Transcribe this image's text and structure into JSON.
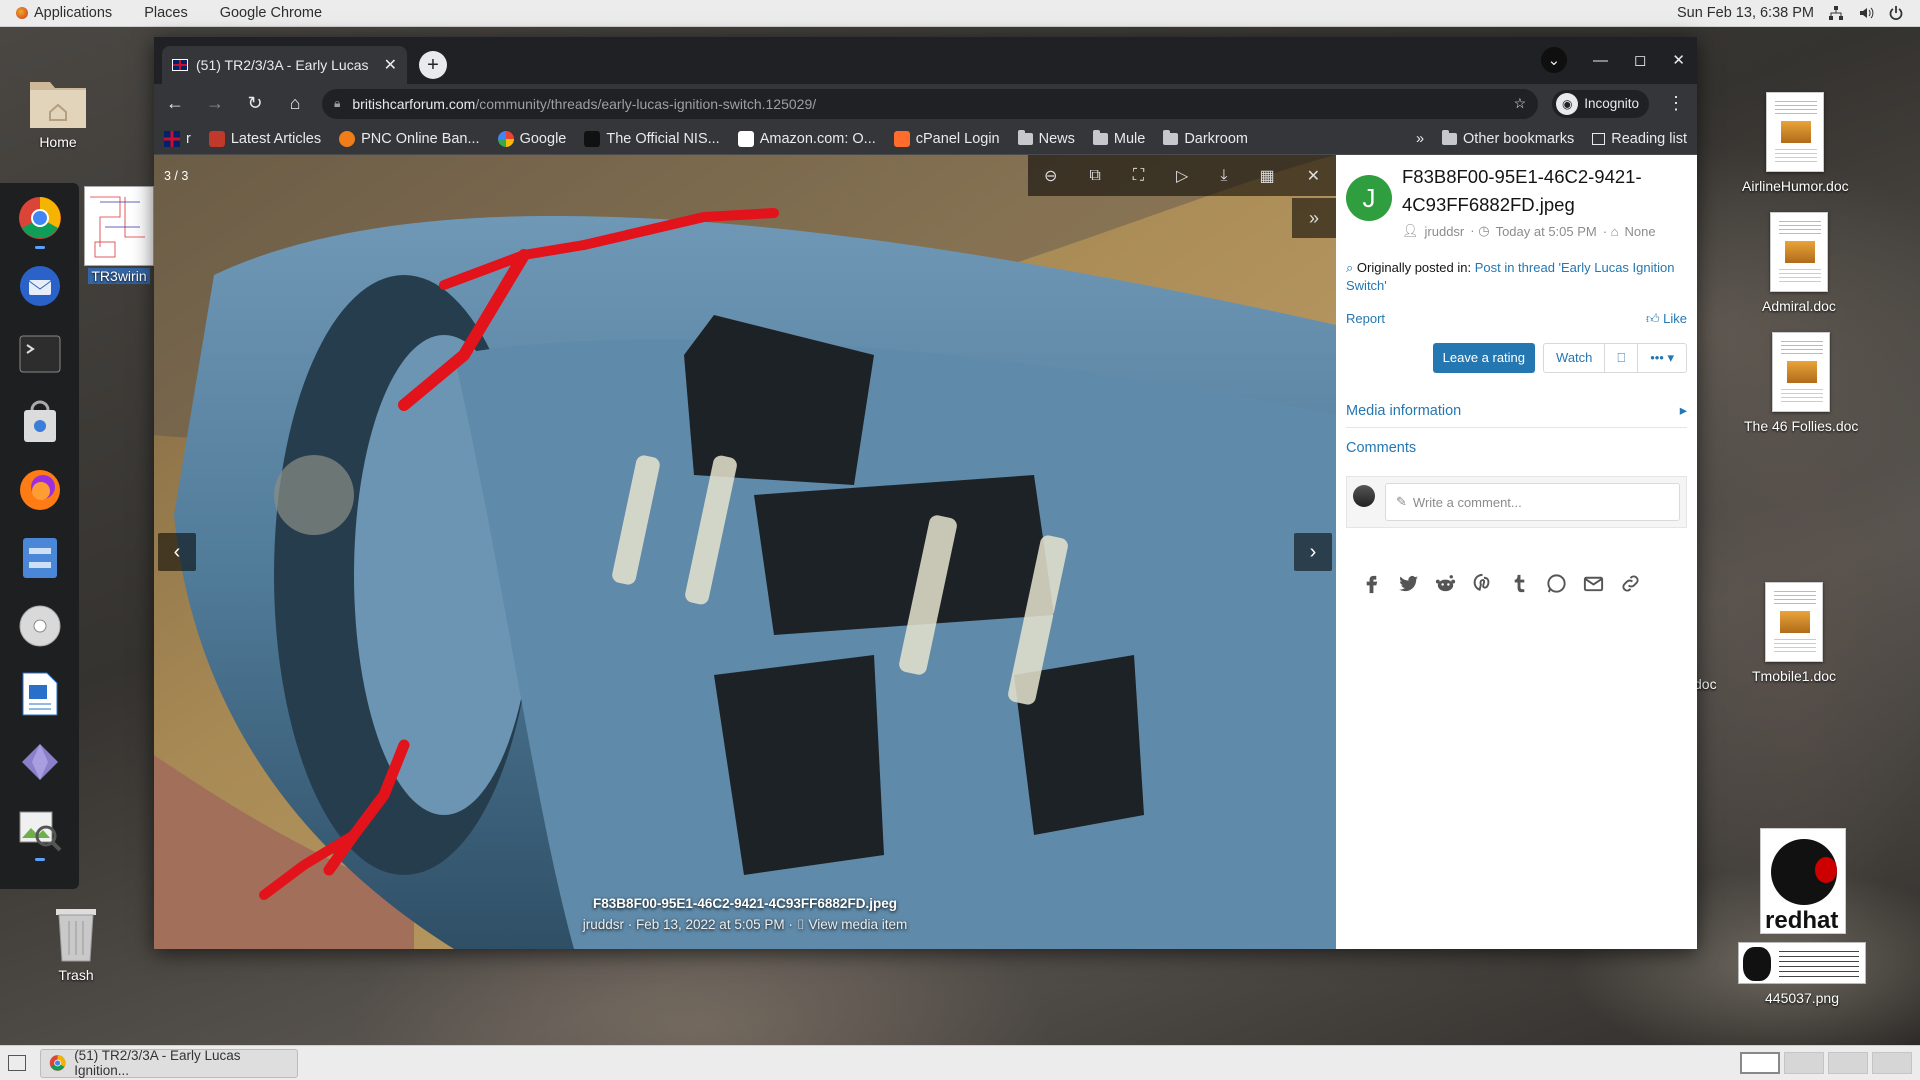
{
  "top_bar": {
    "menus": [
      "Applications",
      "Places",
      "Google Chrome"
    ],
    "datetime": "Sun Feb 13,  6:38 PM"
  },
  "desktop": {
    "home_label": "Home",
    "trash_label": "Trash",
    "partial_icon_label": "TR3wirin",
    "right_icons": [
      {
        "label": "AirlineHumor.doc"
      },
      {
        "label": "Admiral.doc"
      },
      {
        "label": "The 46 Follies.doc"
      },
      {
        "label": "Tmobile1.doc"
      }
    ],
    "partial_doc_label": "doc",
    "redhat_label": "redhat",
    "linuxcounter_label": "445037.png"
  },
  "browser": {
    "tab": {
      "title": "(51) TR2/3/3A - Early Lucas"
    },
    "url_host": "britishcarforum.com",
    "url_path": "/community/threads/early-lucas-ignition-switch.125029/",
    "incognito_label": "Incognito",
    "bookmarks": [
      {
        "label": "r",
        "icon": "uk-flag-icon"
      },
      {
        "label": "Latest Articles",
        "icon": "pin-icon"
      },
      {
        "label": "PNC Online Ban...",
        "icon": "pnc-icon"
      },
      {
        "label": "Google",
        "icon": "google-icon"
      },
      {
        "label": "The Official NIS...",
        "icon": "nist-icon"
      },
      {
        "label": "Amazon.com: O...",
        "icon": "amazon-icon"
      },
      {
        "label": "cPanel Login",
        "icon": "cpanel-icon"
      },
      {
        "label": "News",
        "icon": "folder-icon"
      },
      {
        "label": "Mule",
        "icon": "folder-icon"
      },
      {
        "label": "Darkroom",
        "icon": "folder-icon"
      }
    ],
    "overflow": "»",
    "other_bookmarks": "Other bookmarks",
    "reading_list": "Reading list"
  },
  "lightbox": {
    "counter": "3 / 3",
    "caption_filename": "F83B8F00-95E1-46C2-9421-4C93FF6882FD.jpeg",
    "caption_meta": "jruddsr · Feb 13, 2022 at 5:05 PM · ",
    "caption_link": "View media item"
  },
  "sidebar": {
    "avatar_letter": "J",
    "title": "F83B8F00-95E1-46C2-9421-4C93FF6882FD.jpeg",
    "author": "jruddsr",
    "time": "Today at 5:05 PM",
    "tags": "None",
    "orig_prefix": "Originally posted in:",
    "orig_link": "Post in thread 'Early Lucas Ignition Switch'",
    "report": "Report",
    "like": "Like",
    "leave_rating": "Leave a rating",
    "watch": "Watch",
    "more": "•••",
    "media_info": "Media information",
    "comments": "Comments",
    "comment_placeholder": "Write a comment..."
  },
  "taskbar": {
    "task_title": "(51) TR2/3/3A - Early Lucas Ignition..."
  },
  "colors": {
    "link": "#2577b1",
    "avatar_bg": "#2f9e3f",
    "annotation_red": "#e3131b"
  }
}
